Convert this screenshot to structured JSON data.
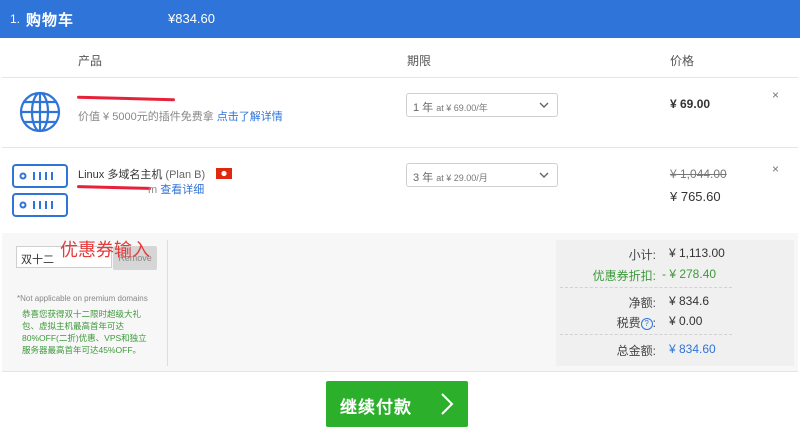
{
  "header": {
    "step": "1.",
    "title": "购物车",
    "total": "¥834.60"
  },
  "columns": {
    "product": "产品",
    "term": "期限",
    "price": "价格"
  },
  "items": [
    {
      "name_redacted": "",
      "sub_prefix": "价值 ¥ 5000元的插件免费拿",
      "link": "点击了解详情",
      "term_value": "1 年",
      "term_at": "at ¥ 69.00/年",
      "price": "¥ 69.00",
      "remove": "×"
    },
    {
      "name": "Linux 多域名主机",
      "plan": "(Plan B)",
      "sub_suffix": "m",
      "link": "查看详细",
      "term_value": "3 年",
      "term_at": "at ¥ 29.00/月",
      "original_price": "¥ 1,044.00",
      "price": "¥ 765.60",
      "remove": "×"
    }
  ],
  "coupon": {
    "value": "双十二",
    "remove_label": "Remove",
    "annotation": "优惠券输入",
    "note": "*Not applicable on premium domains",
    "promo_lines": [
      "恭喜您获得双十二限时超级大礼",
      "包、虚拟主机最高首年可达",
      "80%OFF(二折)优惠、VPS和独立",
      "服务器最高首年可达45%OFF。"
    ]
  },
  "summary": {
    "subtotal_label": "小计:",
    "subtotal": "¥ 1,113.00",
    "discount_label": "优惠券折扣:",
    "discount": "- ¥ 278.40",
    "net_label": "净额:",
    "net": "¥ 834.6",
    "tax_label": "税费",
    "tax_help": "?",
    "tax_colon": ":",
    "tax": "¥ 0.00",
    "total_label": "总金额:",
    "total": "¥ 834.60"
  },
  "checkout": {
    "label": "继续付款"
  },
  "colors": {
    "header": "#2f74d8",
    "accent": "#2f74d8",
    "checkout": "#2cb02c",
    "discount": "#3c9a3a",
    "annotation": "#e53b3b"
  },
  "icons": {
    "item1": "globe-icon",
    "item2": "server-icon",
    "flag": "hong-kong-flag-icon"
  }
}
